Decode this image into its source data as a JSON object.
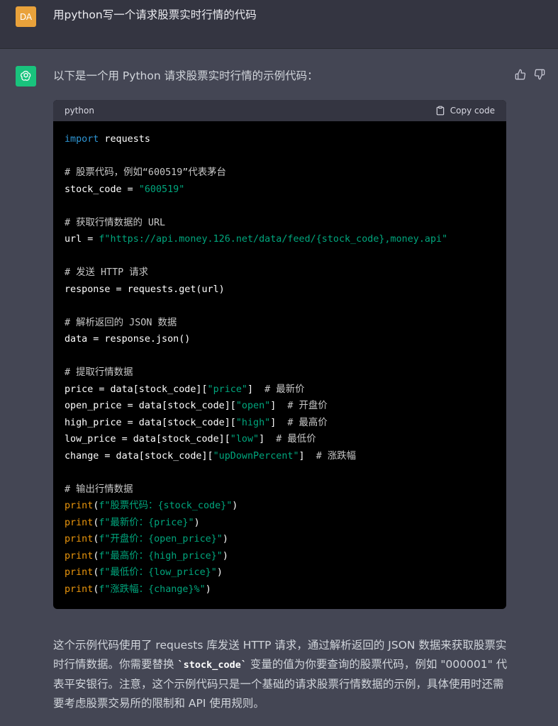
{
  "user": {
    "avatar_initials": "DA",
    "message": "用python写一个请求股票实时行情的代码"
  },
  "assistant": {
    "intro": "以下是一个用 Python 请求股票实时行情的示例代码：",
    "code_block": {
      "language": "python",
      "copy_label": "Copy code",
      "lines": {
        "l1_import": "import",
        "l1_rest": " requests",
        "l3": "# 股票代码，例如“600519”代表茅台",
        "l4_a": "stock_code = ",
        "l4_str": "\"600519\"",
        "l6": "# 获取行情数据的 URL",
        "l7_a": "url = ",
        "l7_str": "f\"https://api.money.126.net/data/feed/{stock_code},money.api\"",
        "l9": "# 发送 HTTP 请求",
        "l10": "response = requests.get(url)",
        "l12": "# 解析返回的 JSON 数据",
        "l13": "data = response.json()",
        "l15": "# 提取行情数据",
        "l16_a": "price = data[stock_code][",
        "l16_str": "\"price\"",
        "l16_b": "]  ",
        "l16_cm": "# 最新价",
        "l17_a": "open_price = data[stock_code][",
        "l17_str": "\"open\"",
        "l17_b": "]  ",
        "l17_cm": "# 开盘价",
        "l18_a": "high_price = data[stock_code][",
        "l18_str": "\"high\"",
        "l18_b": "]  ",
        "l18_cm": "# 最高价",
        "l19_a": "low_price = data[stock_code][",
        "l19_str": "\"low\"",
        "l19_b": "]  ",
        "l19_cm": "# 最低价",
        "l20_a": "change = data[stock_code][",
        "l20_str": "\"upDownPercent\"",
        "l20_b": "]  ",
        "l20_cm": "# 涨跌幅",
        "l22": "# 输出行情数据",
        "print_kw": "print",
        "l23_str": "f\"股票代码：{stock_code}\"",
        "l24_str": "f\"最新价：{price}\"",
        "l25_str": "f\"开盘价：{open_price}\"",
        "l26_str": "f\"最高价：{high_price}\"",
        "l27_str": "f\"最低价：{low_price}\"",
        "l28_str": "f\"涨跌幅：{change}%\""
      }
    },
    "summary_part1": "这个示例代码使用了 requests 库发送 HTTP 请求，通过解析返回的 JSON 数据来获取股票实时行情数据。你需要替换 ",
    "summary_code": "`stock_code`",
    "summary_part2": " 变量的值为你要查询的股票代码，例如 \"000001\" 代表平安银行。注意，这个示例代码只是一个基础的请求股票行情数据的示例，具体使用时还需要考虑股票交易所的限制和 API 使用规则。"
  },
  "colors": {
    "user_avatar": "#e9a23b",
    "assistant_avatar": "#19c37d",
    "keyword": "#2e95d3",
    "string": "#00a67d",
    "print": "#e9950c"
  },
  "icons": [
    "openai-logo-icon",
    "thumbs-up-icon",
    "thumbs-down-icon",
    "clipboard-icon"
  ]
}
